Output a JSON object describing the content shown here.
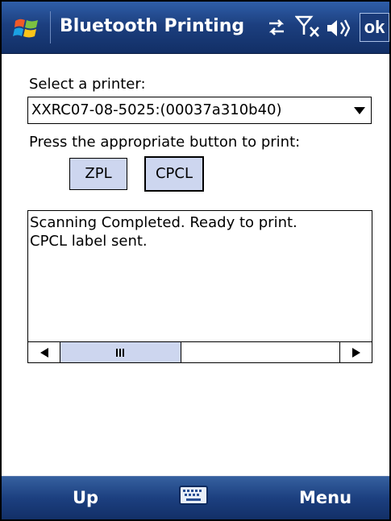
{
  "title_bar": {
    "title": "Bluetooth Printing",
    "ok_label": "ok",
    "icons": [
      "windows-start-flag",
      "sync-arrows",
      "signal-no-service",
      "volume-speaker"
    ]
  },
  "form": {
    "select_label": "Select a printer:",
    "selected_printer": "XXRC07-08-5025:(00037a310b40)",
    "press_label": "Press the appropriate button to print:",
    "zpl_label": "ZPL",
    "cpcl_label": "CPCL"
  },
  "log": {
    "lines": [
      "Scanning Completed. Ready to print.",
      "CPCL label sent."
    ]
  },
  "softkeys": {
    "left": "Up",
    "right": "Menu"
  },
  "colors": {
    "title_bar": "#1c3f7f",
    "button_fill": "#cdd6ef",
    "text": "#000000"
  }
}
